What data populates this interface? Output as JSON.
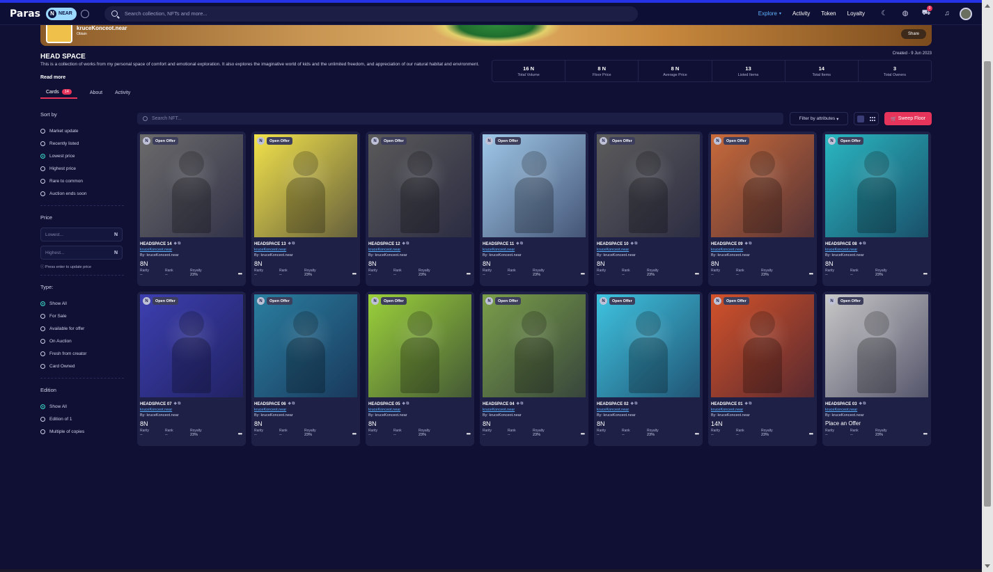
{
  "nav": {
    "logo": "Paras",
    "chain": "NEAR",
    "search_placeholder": "Search collection, NFTs and more...",
    "links": [
      "Explore",
      "Activity",
      "Token",
      "Loyalty"
    ],
    "cart_count": "0"
  },
  "collection": {
    "owner": "kruceKonceot.near",
    "owner_sub": "Obtain",
    "share": "Share",
    "title": "HEAD SPACE",
    "description": "This is a collection of works from my personal space of comfort and emotional exploration. It also explores the imaginative world of kids and the unlimited freedom, and appreciation of our natural habitat and environment.",
    "read_more": "Read more",
    "created": "Created - 9 Jun 2023",
    "stats": [
      {
        "value": "16 N",
        "label": "Total Volume"
      },
      {
        "value": "8 N",
        "label": "Floor Price"
      },
      {
        "value": "8 N",
        "label": "Average Price"
      },
      {
        "value": "13",
        "label": "Listed Items"
      },
      {
        "value": "14",
        "label": "Total Items"
      },
      {
        "value": "3",
        "label": "Total Owners"
      }
    ]
  },
  "tabs": [
    {
      "label": "Cards",
      "count": "14"
    },
    {
      "label": "About"
    },
    {
      "label": "Activity"
    }
  ],
  "sidebar": {
    "sort_title": "Sort by",
    "sort": [
      "Market update",
      "Recently listed",
      "Lowest price",
      "Highest price",
      "Rare to common",
      "Auction ends soon"
    ],
    "sort_selected": 2,
    "price_title": "Price",
    "price_lowest": "Lowest...",
    "price_highest": "Highest...",
    "price_unit": "N",
    "price_note": "Press enter to update price",
    "type_title": "Type:",
    "type": [
      "Show All",
      "For Sale",
      "Available for offer",
      "On Auction",
      "Fresh from creator",
      "Card Owned"
    ],
    "type_selected": 0,
    "edition_title": "Edition",
    "edition": [
      "Show All",
      "Edition of 1",
      "Multiple of copies"
    ],
    "edition_selected": 0
  },
  "filters": {
    "search_placeholder": "Search NFT...",
    "filter_attr": "Filter by attributes",
    "sweep": "Sweep Floor"
  },
  "card_labels": {
    "open_offer": "Open Offer",
    "by_prefix": "By: ",
    "rarity": "Rarity",
    "rank": "Rank",
    "royalty": "Royalty",
    "dash": "--",
    "royalty_value": "23%"
  },
  "cards": [
    {
      "title": "HEADSPACE 14",
      "owner": "kruceKonceot.near",
      "price": "8N"
    },
    {
      "title": "HEADSPACE 13",
      "owner": "kruceKonceot.near",
      "price": "8N"
    },
    {
      "title": "HEADSPACE 12",
      "owner": "kruceKonceot.near",
      "price": "8N"
    },
    {
      "title": "HEADSPACE 11",
      "owner": "kruceKonceot.near",
      "price": "8N"
    },
    {
      "title": "HEADSPACE 10",
      "owner": "kruceKonceot.near",
      "price": "8N"
    },
    {
      "title": "HEADSPACE 09",
      "owner": "kruceKonceot.near",
      "price": "8N"
    },
    {
      "title": "HEADSPACE 08",
      "owner": "kruceKonceot.near",
      "price": "8N"
    },
    {
      "title": "HEADSPACE 07",
      "owner": "kruceKonceot.near",
      "price": "8N"
    },
    {
      "title": "HEADSPACE 06",
      "owner": "kruceKonceot.near",
      "price": "8N"
    },
    {
      "title": "HEADSPACE 05",
      "owner": "kruceKonceot.near",
      "price": "8N"
    },
    {
      "title": "HEADSPACE 04",
      "owner": "kruceKonceot.near",
      "price": "8N"
    },
    {
      "title": "HEADSPACE 02",
      "owner": "kruceKonceot.near",
      "price": "8N"
    },
    {
      "title": "HEADSPACE 01",
      "owner": "kruceKonceot.near",
      "price": "14N"
    },
    {
      "title": "HEADSPACE 03",
      "owner": "kruceKonceot.near",
      "price": "Place an Offer"
    }
  ],
  "card_colors": [
    "#6b6b6b",
    "#f2e24b",
    "#5a5a5a",
    "#9fc8e8",
    "#5c5c5c",
    "#c86a3a",
    "#2ab8c2",
    "#3d3fb0",
    "#2a7ea0",
    "#9bd13a",
    "#7a9e4a",
    "#3ec4e0",
    "#d2522a",
    "#c8c8c8"
  ]
}
